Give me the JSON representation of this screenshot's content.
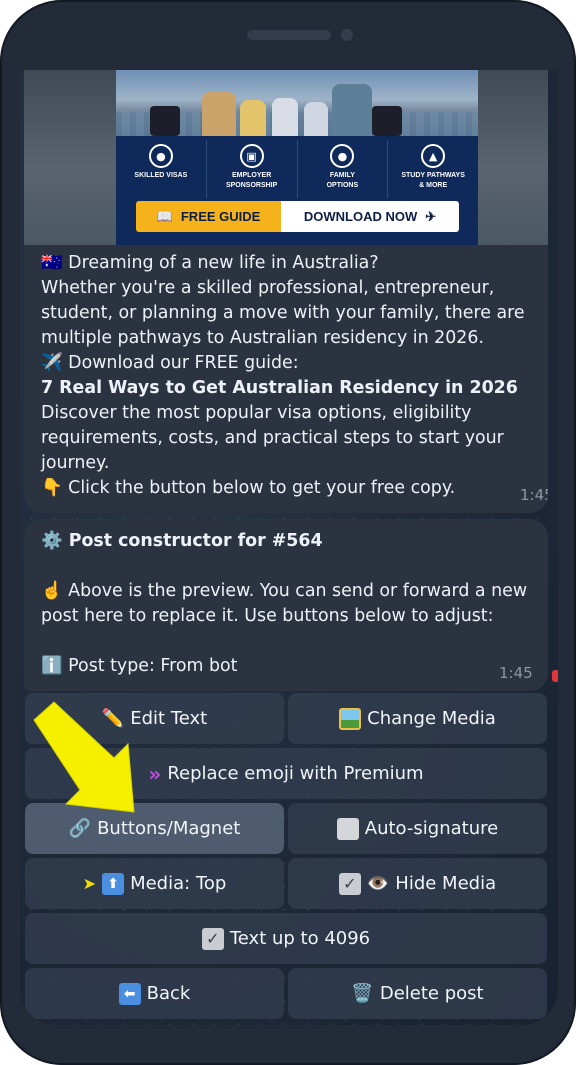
{
  "banner": {
    "features": [
      {
        "icon": "skilled-visas-icon",
        "label": "SKILLED VISAS"
      },
      {
        "icon": "employer-sponsorship-icon",
        "label": "EMPLOYER SPONSORSHIP"
      },
      {
        "icon": "family-options-icon",
        "label": "FAMILY OPTIONS"
      },
      {
        "icon": "study-pathways-icon",
        "label": "STUDY PATHWAYS & MORE"
      }
    ],
    "cta_left": "FREE GUIDE",
    "cta_right": "DOWNLOAD NOW"
  },
  "post": {
    "lines": [
      "🇦🇺 Dreaming of a new life in Australia?",
      "Whether you're a skilled professional, entrepreneur,",
      "student, or planning a move with your family, there are",
      "multiple pathways to Australian residency in 2026.",
      "✈️ Download our FREE guide:",
      "7 Real Ways to Get Australian Residency in 2026",
      "Discover the most popular visa options, eligibility",
      "requirements, costs, and practical steps to start your",
      "journey.",
      "👇 Click the button below to get your free copy."
    ],
    "time": "1:45"
  },
  "constructor": {
    "title": "⚙️ Post constructor for #564",
    "desc_line1": "☝️ Above is the preview. You can send or forward a new",
    "desc_line2": "post here to replace it. Use buttons below to adjust:",
    "type": "ℹ️ Post type: From bot",
    "time": "1:45"
  },
  "buttons": {
    "edit_text": "Edit Text",
    "change_media": "Change Media",
    "replace_emoji": "Replace emoji with Premium",
    "buttons_magnet": "Buttons/Magnet",
    "auto_signature": "Auto-signature",
    "media_top": "Media: Top",
    "hide_media": "Hide Media",
    "text_up_to": "Text up to 4096",
    "back": "Back",
    "delete_post": "Delete post"
  },
  "colors": {
    "arrow": "#f5f000",
    "bubble": "#2b3340",
    "button": "#344052"
  }
}
